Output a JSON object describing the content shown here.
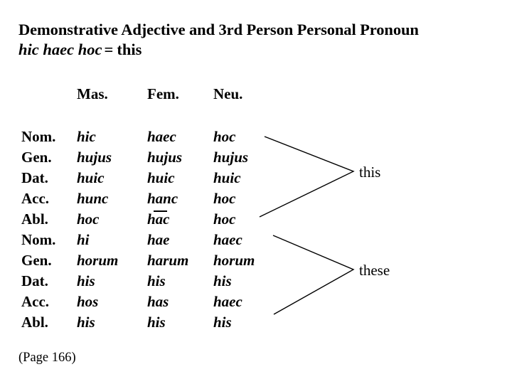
{
  "slide": {
    "background_color": "#ffffff",
    "text_color": "#000000"
  },
  "title": {
    "line1": "Demonstrative Adjective and 3rd Person Personal Pronoun",
    "latin": "hic  haec  hoc",
    "equals": "=",
    "gloss": "this"
  },
  "table": {
    "column_headers": [
      "Mas.",
      "Fem.",
      "Neu."
    ],
    "case_labels": [
      "Nom.",
      "Gen.",
      "Dat.",
      "Acc.",
      "Abl.",
      "Nom.",
      "Gen.",
      "Dat.",
      "Acc.",
      "Abl."
    ],
    "rows": [
      {
        "case": "Nom.",
        "mas": "hic",
        "fem": "haec",
        "neu": "hoc"
      },
      {
        "case": "Gen.",
        "mas": "hujus",
        "fem": "hujus",
        "neu": "hujus"
      },
      {
        "case": "Dat.",
        "mas": "huic",
        "fem": "huic",
        "neu": "huic"
      },
      {
        "case": "Acc.",
        "mas": "hunc",
        "fem": "hanc",
        "neu": "hoc"
      },
      {
        "case": "Abl.",
        "mas": "hoc",
        "fem": "hac",
        "neu": "hoc"
      },
      {
        "case": "Nom.",
        "mas": "hi",
        "fem": "hae",
        "neu": "haec"
      },
      {
        "case": "Gen.",
        "mas": "horum",
        "fem": "harum",
        "neu": "horum"
      },
      {
        "case": "Dat.",
        "mas": "his",
        "fem": "his",
        "neu": "his"
      },
      {
        "case": "Acc.",
        "mas": "hos",
        "fem": "has",
        "neu": "haec"
      },
      {
        "case": "Abl.",
        "mas": "his",
        "fem": "his",
        "neu": "his"
      }
    ]
  },
  "annotations": {
    "singular_gloss": "this",
    "plural_gloss": "these"
  },
  "footer": {
    "page_reference": "(Page 166)"
  }
}
